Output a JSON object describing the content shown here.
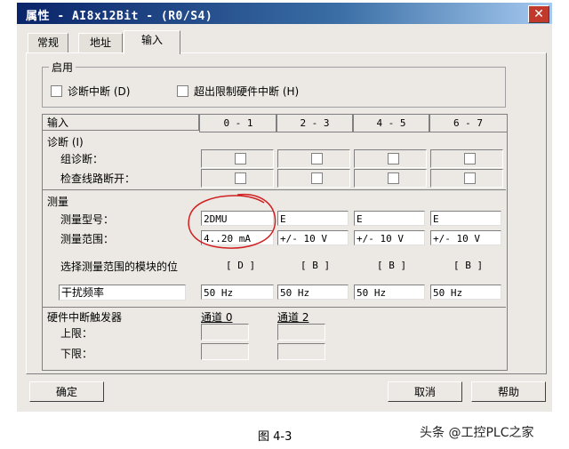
{
  "window": {
    "title": "属性 - AI8x12Bit - (R0/S4)",
    "close_icon": "close-icon"
  },
  "tabs": [
    {
      "label": "常规"
    },
    {
      "label": "地址"
    },
    {
      "label": "输入"
    }
  ],
  "enable_group": {
    "title": "启用",
    "diag_interrupt": "诊断中断 (D)",
    "limit_interrupt": "超出限制硬件中断 (H)"
  },
  "table": {
    "header": {
      "input": "输入",
      "cols": [
        "0 - 1",
        "2 - 3",
        "4 - 5",
        "6 - 7"
      ]
    },
    "diagnostics": {
      "title": "诊断 (I)",
      "group_diag": "组诊断：",
      "wire_break": "检查线路断开："
    },
    "measurement": {
      "title": "测量",
      "type_label": "测量型号：",
      "range_label": "测量范围：",
      "types": [
        "2DMU",
        "E",
        "E",
        "E"
      ],
      "ranges": [
        "4..20 mA",
        "+/- 10 V",
        "+/- 10 V",
        "+/- 10 V"
      ],
      "module_pos_label": "选择测量范围的模块的位",
      "module_positions": [
        "[ D ]",
        "[ B ]",
        "[ B ]",
        "[ B ]"
      ]
    },
    "interference": {
      "label": "干扰频率",
      "values": [
        "50 Hz",
        "50 Hz",
        "50 Hz",
        "50 Hz"
      ]
    },
    "hw_interrupt": {
      "title": "硬件中断触发器",
      "upper": "上限：",
      "lower": "下限：",
      "channel0": "通道 0",
      "channel2": "通道 2"
    }
  },
  "buttons": {
    "ok": "确定",
    "cancel": "取消",
    "help": "帮助"
  },
  "caption": "图 4-3",
  "watermark": "头条 @工控PLC之家",
  "colors": {
    "title_bar": "#0a246a",
    "annotation_circle": "#d02020",
    "close_button": "#c0392b"
  }
}
